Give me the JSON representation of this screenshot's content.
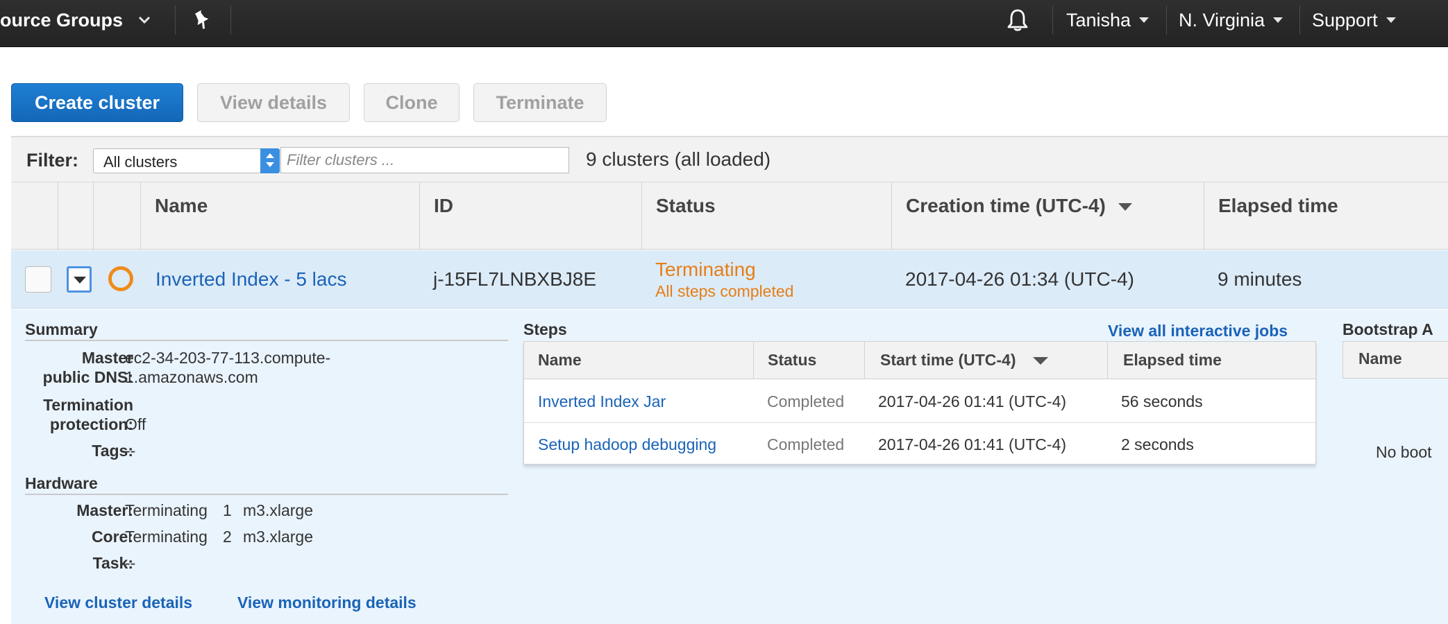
{
  "topnav": {
    "service_menu": "ource Groups",
    "user": "Tanisha",
    "region": "N. Virginia",
    "support": "Support"
  },
  "toolbar": {
    "create": "Create cluster",
    "view_details": "View details",
    "clone": "Clone",
    "terminate": "Terminate"
  },
  "filter": {
    "label": "Filter:",
    "selected": "All clusters",
    "placeholder": "Filter clusters ...",
    "count": "9 clusters (all loaded)"
  },
  "table": {
    "headers": {
      "name": "Name",
      "id": "ID",
      "status": "Status",
      "creation": "Creation time (UTC-4)",
      "elapsed": "Elapsed time"
    },
    "row": {
      "name": "Inverted Index - 5 lacs",
      "id": "j-15FL7LNBXBJ8E",
      "status": "Terminating",
      "status_detail": "All steps completed",
      "creation": "2017-04-26 01:34 (UTC-4)",
      "elapsed": "9 minutes"
    }
  },
  "summary": {
    "title": "Summary",
    "dns_label_1": "Master",
    "dns_label_2": "public DNS:",
    "dns_value_1": "ec2-34-203-77-113.compute-",
    "dns_value_2": "1.amazonaws.com",
    "term_label_1": "Termination",
    "term_label_2": "protection:",
    "term_value": "Off",
    "tags_label": "Tags:",
    "tags_value": "--"
  },
  "hardware": {
    "title": "Hardware",
    "master_label": "Master:",
    "master_state": "Terminating",
    "master_count": "1",
    "master_type": "m3.xlarge",
    "core_label": "Core:",
    "core_state": "Terminating",
    "core_count": "2",
    "core_type": "m3.xlarge",
    "task_label": "Task:",
    "task_value": "--"
  },
  "links": {
    "cluster_details": "View cluster details",
    "monitoring_details": "View monitoring details"
  },
  "steps": {
    "title": "Steps",
    "view_all": "View all interactive jobs",
    "headers": {
      "name": "Name",
      "status": "Status",
      "start": "Start time (UTC-4)",
      "elapsed": "Elapsed time"
    },
    "rows": [
      {
        "name": "Inverted Index Jar",
        "status": "Completed",
        "start": "2017-04-26 01:41 (UTC-4)",
        "elapsed": "56 seconds"
      },
      {
        "name": "Setup hadoop debugging",
        "status": "Completed",
        "start": "2017-04-26 01:41 (UTC-4)",
        "elapsed": "2 seconds"
      }
    ]
  },
  "bootstrap": {
    "title": "Bootstrap A",
    "header_name": "Name",
    "empty": "No boot"
  }
}
